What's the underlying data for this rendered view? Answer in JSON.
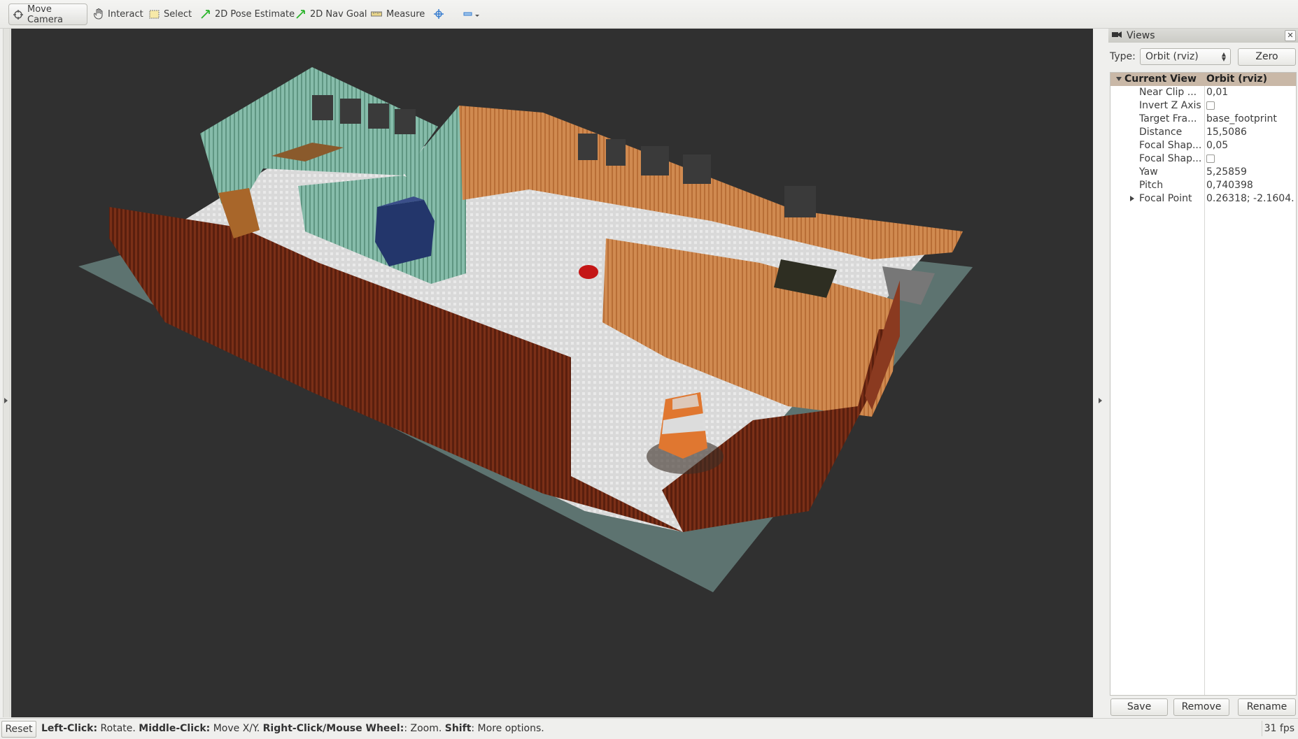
{
  "toolbar": {
    "tools": [
      {
        "label": "Move Camera",
        "icon": "move-camera-icon",
        "active": true
      },
      {
        "label": "Interact",
        "icon": "hand-icon",
        "active": false
      },
      {
        "label": "Select",
        "icon": "select-box-icon",
        "active": false
      },
      {
        "label": "2D Pose Estimate",
        "icon": "green-arrow-icon",
        "active": false
      },
      {
        "label": "2D Nav Goal",
        "icon": "green-arrow-icon",
        "active": false
      },
      {
        "label": "Measure",
        "icon": "ruler-icon",
        "active": false
      }
    ],
    "add_tool_icon": "plus-crosshair-icon",
    "remove_tool_icon": "minus-dropdown-icon"
  },
  "views_panel": {
    "title": "Views",
    "type_label": "Type:",
    "type_value": "Orbit (rviz)",
    "zero_button": "Zero",
    "current_view": {
      "label": "Current View",
      "value": "Orbit (rviz)"
    },
    "properties": [
      {
        "name": "Near Clip ...",
        "value": "0,01",
        "kind": "text"
      },
      {
        "name": "Invert Z Axis",
        "value": "",
        "kind": "checkbox",
        "checked": false
      },
      {
        "name": "Target Fra...",
        "value": "base_footprint",
        "kind": "text"
      },
      {
        "name": "Distance",
        "value": "15,5086",
        "kind": "text"
      },
      {
        "name": "Focal Shap...",
        "value": "0,05",
        "kind": "text"
      },
      {
        "name": "Focal Shap...",
        "value": "",
        "kind": "checkbox",
        "checked": false
      },
      {
        "name": "Yaw",
        "value": "5,25859",
        "kind": "text"
      },
      {
        "name": "Pitch",
        "value": "0,740398",
        "kind": "text"
      },
      {
        "name": "Focal Point",
        "value": "0.26318; -2.1604...",
        "kind": "expandable"
      }
    ],
    "buttons": {
      "save": "Save",
      "remove": "Remove",
      "rename": "Rename"
    }
  },
  "status": {
    "reset": "Reset",
    "hint_parts": [
      {
        "bold": "Left-Click:",
        "text": " Rotate. "
      },
      {
        "bold": "Middle-Click:",
        "text": " Move X/Y. "
      },
      {
        "bold": "Right-Click/Mouse Wheel:",
        "text": ": Zoom. "
      },
      {
        "bold": "Shift",
        "text": ": More options."
      }
    ],
    "fps": "31 fps"
  },
  "colors": {
    "viewport_bg": "#303030",
    "ground_plane": "#5d7370",
    "floor": "#d8d8d8",
    "teal_wall": "#7fb3a3",
    "orange_wall": "#cc7f45",
    "brown_wall": "#6e2a15",
    "panel_header": "#c9b8a7"
  }
}
